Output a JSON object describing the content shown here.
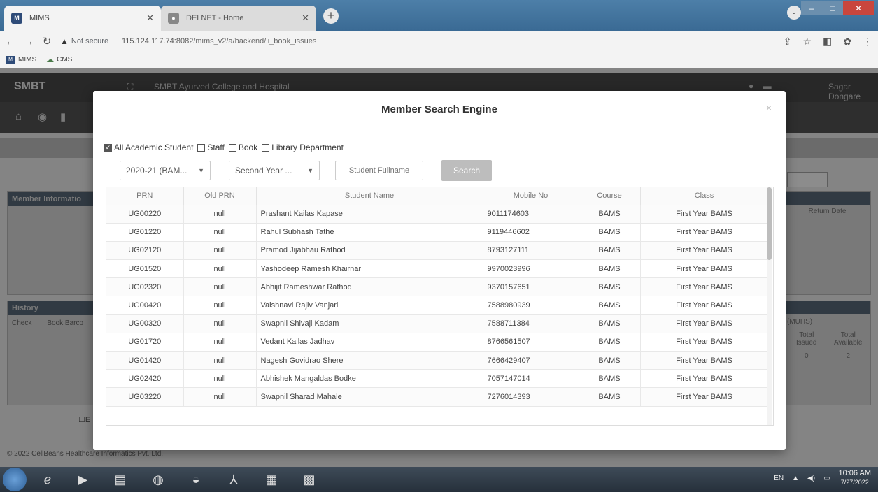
{
  "browser": {
    "tabs": [
      {
        "label": "MIMS",
        "favicon": "MIMS",
        "active": true
      },
      {
        "label": "DELNET - Home",
        "favicon": "delnet",
        "active": false
      }
    ],
    "security_label": "Not secure",
    "url_host": "115.124.117.74:8082",
    "url_path": "/mims_v2/a/backend/li_book_issues",
    "bookmarks": [
      {
        "label": "MIMS"
      },
      {
        "label": "CMS"
      }
    ]
  },
  "app": {
    "brand": "SMBT",
    "college": "SMBT Ayurved College and Hospital",
    "user": "Sagar Dongare",
    "member_panel_title": "Member Informatio",
    "history_title": "History",
    "history_columns": [
      "Check",
      "Book Barco"
    ],
    "return_date_label": "Return Date",
    "muhs_label": "(MUHS)",
    "total_issued_label": "Total Issued",
    "total_available_label": "Total Available",
    "total_issued_value": "0",
    "total_available_value": "2",
    "footer": "© 2022 CellBeans Healthcare Informatics Pvt. Ltd.",
    "checkbox_e": "E"
  },
  "modal": {
    "title": "Member Search Engine",
    "close": "×",
    "filters": [
      {
        "label": "All Academic Student",
        "checked": true
      },
      {
        "label": "Staff",
        "checked": false
      },
      {
        "label": "Book",
        "checked": false
      },
      {
        "label": "Library Department",
        "checked": false
      }
    ],
    "session_select": "2020-21 (BAM...",
    "year_select": "Second Year ...",
    "search_placeholder": "Student Fullname",
    "search_button": "Search",
    "columns": [
      "PRN",
      "Old PRN",
      "Student Name",
      "Mobile No",
      "Course",
      "Class"
    ],
    "rows": [
      [
        "UG00220",
        "null",
        "Prashant Kailas Kapase",
        "9011174603",
        "BAMS",
        "First Year BAMS"
      ],
      [
        "UG01220",
        "null",
        "Rahul Subhash Tathe",
        "9119446602",
        "BAMS",
        "First Year BAMS"
      ],
      [
        "UG02120",
        "null",
        "Pramod Jijabhau Rathod",
        "8793127111",
        "BAMS",
        "First Year BAMS"
      ],
      [
        "UG01520",
        "null",
        "Yashodeep Ramesh Khairnar",
        "9970023996",
        "BAMS",
        "First Year BAMS"
      ],
      [
        "UG02320",
        "null",
        "Abhijit Rameshwar Rathod",
        "9370157651",
        "BAMS",
        "First Year BAMS"
      ],
      [
        "UG00420",
        "null",
        "Vaishnavi Rajiv Vanjari",
        "7588980939",
        "BAMS",
        "First Year BAMS"
      ],
      [
        "UG00320",
        "null",
        "Swapnil Shivaji Kadam",
        "7588711384",
        "BAMS",
        "First Year BAMS"
      ],
      [
        "UG01720",
        "null",
        "Vedant Kailas Jadhav",
        "8766561507",
        "BAMS",
        "First Year BAMS"
      ],
      [
        "UG01420",
        "null",
        "Nagesh Govidrao Shere",
        "7666429407",
        "BAMS",
        "First Year BAMS"
      ],
      [
        "UG02420",
        "null",
        "Abhishek Mangaldas Bodke",
        "7057147014",
        "BAMS",
        "First Year BAMS"
      ],
      [
        "UG03220",
        "null",
        "Swapnil Sharad Mahale",
        "7276014393",
        "BAMS",
        "First Year BAMS"
      ]
    ]
  },
  "taskbar": {
    "lang": "EN",
    "time": "10:06 AM",
    "date": "7/27/2022"
  },
  "colors": {
    "tabstrip": "#4d7fa8",
    "app_header": "#4a4a4a",
    "search_button": "#bdbdbd",
    "close_button": "#c9463d"
  }
}
